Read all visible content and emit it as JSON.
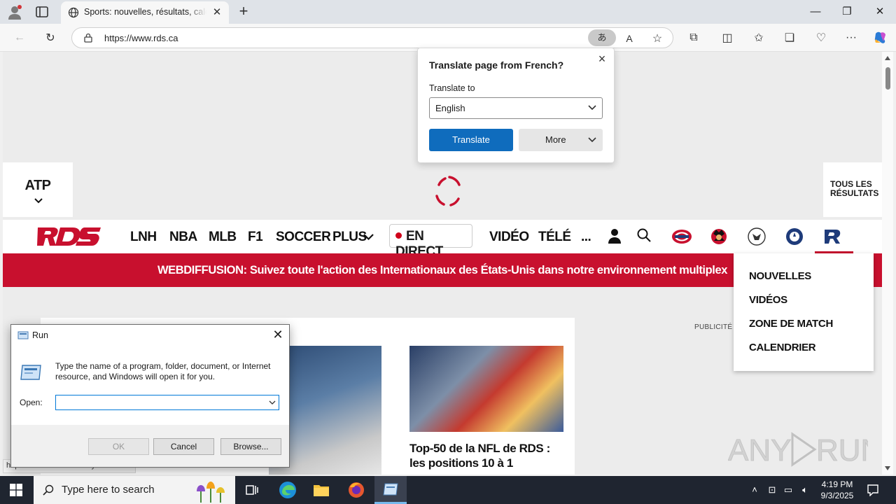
{
  "browser": {
    "tab_title": "Sports: nouvelles, résultats, calendriers",
    "url": "https://www.rds.ca",
    "translate_icon": "translate-icon"
  },
  "translate_popup": {
    "title": "Translate page from French?",
    "to_label": "Translate to",
    "language": "English",
    "translate_button": "Translate",
    "more_button": "More"
  },
  "page": {
    "scorebox_label": "ATP",
    "all_results_line1": "TOUS LES",
    "all_results_line2": "RÉSULTATS",
    "nav": [
      "LNH",
      "NBA",
      "MLB",
      "F1",
      "SOCCER",
      "PLUS",
      "EN DIRECT",
      "VIDÉO",
      "TÉLÉ",
      "..."
    ],
    "banner": "WEBDIFFUSION: Suivez toute l'action des Internationaux des États-Unis dans notre environnement multiplex",
    "dropdown": [
      "NOUVELLES",
      "VIDÉOS",
      "ZONE DE MATCH",
      "CALENDRIER"
    ],
    "publicity": "PUBLICITÉ",
    "article_title": "Top-50 de la NFL de RDS : les positions 10 à 1",
    "status_url": "https://www.rds.ca/hockey/rocket",
    "watermark": "ANY RUN",
    "accent_color": "#c8102e"
  },
  "run_dialog": {
    "title": "Run",
    "description": "Type the name of a program, folder, document, or Internet resource, and Windows will open it for you.",
    "open_label": "Open:",
    "open_value": "",
    "ok": "OK",
    "cancel": "Cancel",
    "browse": "Browse..."
  },
  "taskbar": {
    "search_placeholder": "Type here to search",
    "time": "4:19 PM",
    "date": "9/3/2025"
  }
}
